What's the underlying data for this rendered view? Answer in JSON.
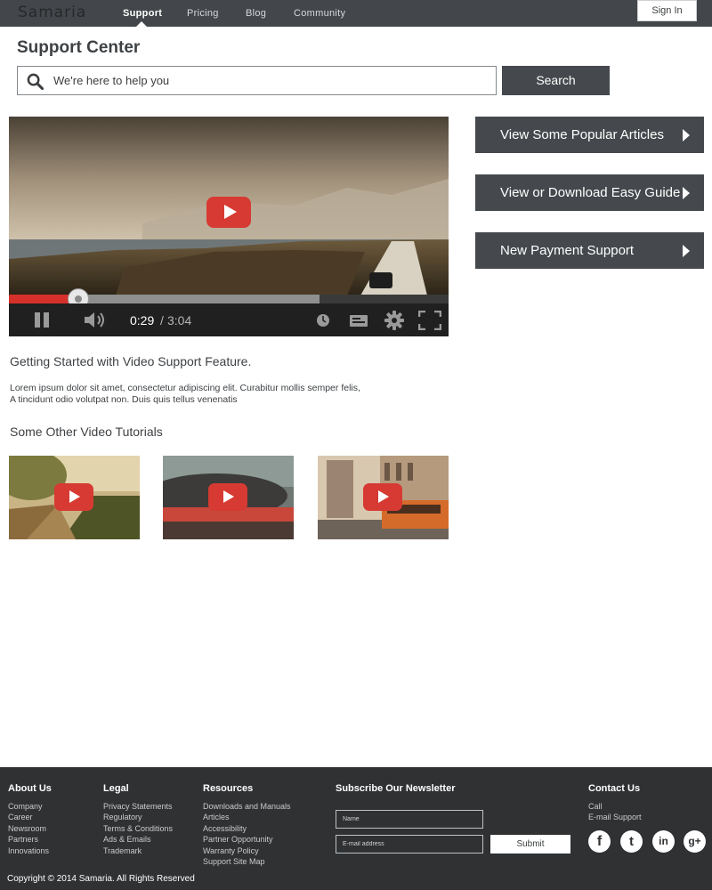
{
  "brand": {
    "name": "Samaria"
  },
  "nav": {
    "items": [
      {
        "label": "Support",
        "active": true
      },
      {
        "label": "Pricing",
        "active": false
      },
      {
        "label": "Blog",
        "active": false
      },
      {
        "label": "Community",
        "active": false
      }
    ],
    "signin_label": "Sign In"
  },
  "support": {
    "title": "Support Center",
    "search_placeholder": "We're here to help you",
    "search_button": "Search"
  },
  "video": {
    "current_time": "0:29",
    "separator": "/",
    "total_time": "3:04",
    "played_fraction": 0.158,
    "buffered_fraction": 0.706
  },
  "side_buttons": [
    {
      "label": "View Some Popular Articles"
    },
    {
      "label": "View or Download Easy Guide"
    },
    {
      "label": "New Payment Support"
    }
  ],
  "article": {
    "title": "Getting Started with Video Support Feature.",
    "body_line1": "Lorem ipsum dolor sit amet, consectetur adipiscing elit. Curabitur mollis semper felis,",
    "body_line2": "A tincidunt odio volutpat non. Duis quis tellus venenatis"
  },
  "tutorials": {
    "title": "Some Other Video Tutorials"
  },
  "footer": {
    "about": {
      "heading": "About Us",
      "links": [
        "Company",
        "Career",
        "Newsroom",
        "Partners",
        "Innovations"
      ]
    },
    "legal": {
      "heading": "Legal",
      "links": [
        "Privacy Statements",
        "Regulatory",
        "Terms & Conditions",
        "Ads & Emails",
        "Trademark"
      ]
    },
    "resources": {
      "heading": "Resources",
      "links": [
        "Downloads and Manuals",
        "Articles",
        "Accessibility",
        "Partner Opportunity",
        "Warranty Policy",
        "Support Site Map"
      ]
    },
    "newsletter": {
      "heading": "Subscribe Our Newsletter",
      "name_placeholder": "Name",
      "email_placeholder": "E-mail address",
      "submit_label": "Submit"
    },
    "contact": {
      "heading": "Contact Us",
      "links": [
        "Call",
        "E-mail Support"
      ]
    },
    "social": [
      {
        "icon": "facebook-icon",
        "glyph": "f"
      },
      {
        "icon": "twitter-icon",
        "glyph": "t"
      },
      {
        "icon": "linkedin-icon",
        "glyph": "in"
      },
      {
        "icon": "google-plus-icon",
        "glyph": "g+"
      }
    ],
    "copyright": "Copyright © 2014 Samaria. All Rights Reserved"
  },
  "colors": {
    "nav_bar": "#43474b",
    "button_dark": "#45494d",
    "play_red": "#d63a32",
    "progress_red": "#d6302a",
    "footer_bg": "#2f3133"
  }
}
